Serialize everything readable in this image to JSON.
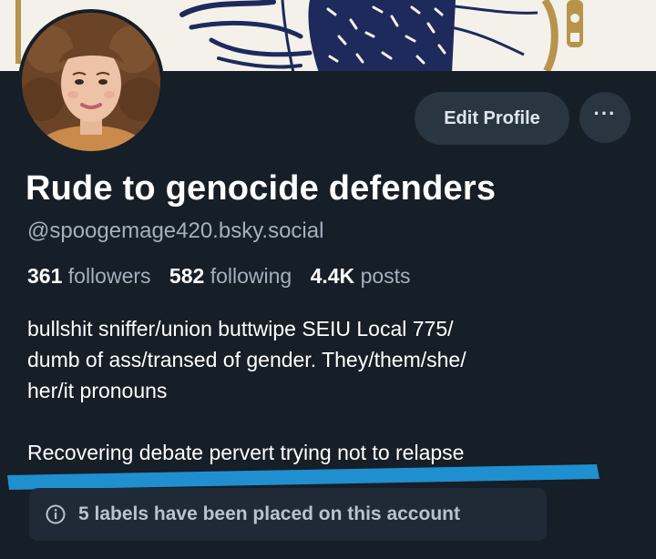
{
  "profile": {
    "display_name": "Rude to genocide defenders",
    "handle": "@spoogemage420.bsky.social",
    "stats": {
      "followers_count": "361",
      "followers_label": "followers",
      "following_count": "582",
      "following_label": "following",
      "posts_count": "4.4K",
      "posts_label": "posts"
    },
    "bio": {
      "line1": "bullshit sniffer/union buttwipe SEIU Local 775/",
      "line2": "dumb of ass/transed of gender. They/them/she/",
      "line3": "her/it pronouns",
      "line4": "Recovering debate pervert trying not to relapse"
    }
  },
  "actions": {
    "edit_profile_label": "Edit Profile",
    "more_label": "···"
  },
  "labels_notice": {
    "text": "5 labels have been placed on this account"
  },
  "colors": {
    "background": "#161e27",
    "button_bg": "#2a3542",
    "muted_text": "#a3b0bf",
    "underline_blue": "#1f8fd0",
    "banner_bg": "#f3f1ea"
  },
  "icons": {
    "avatar": "avatar",
    "more": "ellipsis-icon",
    "labels": "info-icon"
  }
}
